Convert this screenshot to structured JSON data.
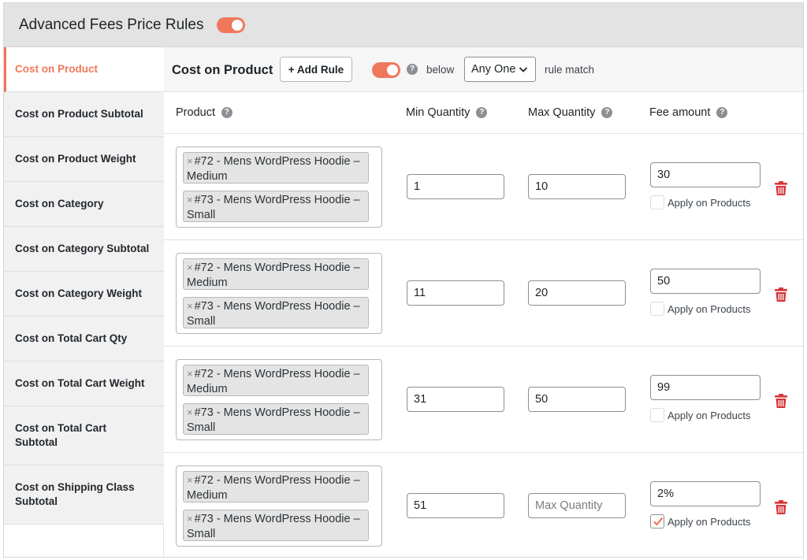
{
  "header": {
    "title": "Advanced Fees Price Rules",
    "toggle_on": true
  },
  "sidebar": {
    "items": [
      {
        "label": "Cost on Product",
        "active": true
      },
      {
        "label": "Cost on Product Subtotal"
      },
      {
        "label": "Cost on Product Weight"
      },
      {
        "label": "Cost on Category"
      },
      {
        "label": "Cost on Category Subtotal"
      },
      {
        "label": "Cost on Category Weight"
      },
      {
        "label": "Cost on Total Cart Qty"
      },
      {
        "label": "Cost on Total Cart Weight"
      },
      {
        "label": "Cost on Total Cart Subtotal"
      },
      {
        "label": "Cost on Shipping Class Subtotal"
      }
    ]
  },
  "toolbar": {
    "title": "Cost on Product",
    "add_rule_label": "+ Add Rule",
    "toggle_on": true,
    "below_label": "below",
    "match_value": "Any One",
    "rule_match_label": "rule match"
  },
  "columns": {
    "product": "Product",
    "min_quantity": "Min Quantity",
    "max_quantity": "Max Quantity",
    "fee_amount": "Fee amount"
  },
  "rules": [
    {
      "products": [
        "#72 - Mens WordPress Hoodie – Medium",
        "#73 - Mens WordPress Hoodie – Small"
      ],
      "min_qty": "1",
      "max_qty": "10",
      "fee": "30",
      "apply_label": "Apply on Products",
      "apply_checked": false
    },
    {
      "products": [
        "#72 - Mens WordPress Hoodie – Medium",
        "#73 - Mens WordPress Hoodie – Small"
      ],
      "min_qty": "11",
      "max_qty": "20",
      "fee": "50",
      "apply_label": "Apply on Products",
      "apply_checked": false
    },
    {
      "products": [
        "#72 - Mens WordPress Hoodie – Medium",
        "#73 - Mens WordPress Hoodie – Small"
      ],
      "min_qty": "31",
      "max_qty": "50",
      "fee": "99",
      "apply_label": "Apply on Products",
      "apply_checked": false
    },
    {
      "products": [
        "#72 - Mens WordPress Hoodie – Medium",
        "#73 - Mens WordPress Hoodie – Small"
      ],
      "min_qty": "51",
      "max_qty": "",
      "max_qty_placeholder": "Max Quantity",
      "fee": "2%",
      "apply_label": "Apply on Products",
      "apply_checked": true
    }
  ],
  "colors": {
    "accent": "#f0785a",
    "delete": "#d63638",
    "header_bg": "#e3e3e3"
  },
  "icons": {
    "help": "help-circle-icon",
    "delete": "trash-icon",
    "chevron": "chevron-down-icon",
    "remove_tag": "close-icon"
  }
}
